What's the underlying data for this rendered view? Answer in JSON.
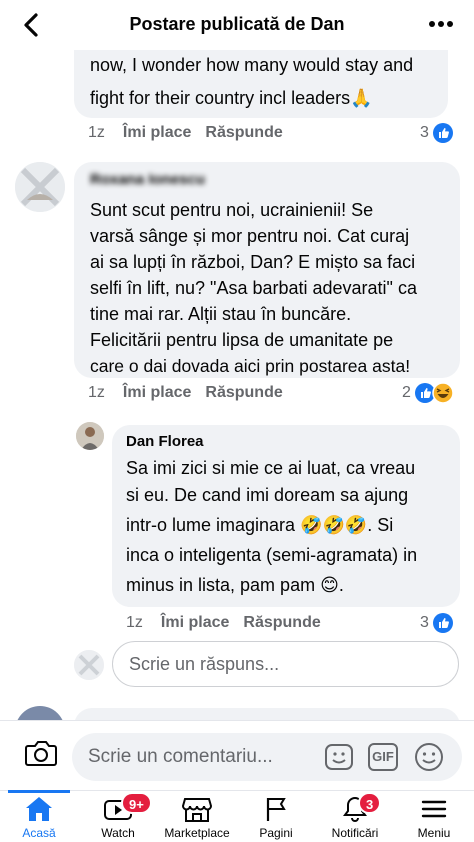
{
  "header": {
    "title": "Postare publicată de Dan",
    "back_icon": "chevron-left-icon",
    "more_icon": "more-dots-icon"
  },
  "comment1": {
    "text_line1": "now, I wonder how many would stay and",
    "text_line2": "fight for their country incl leaders🙏",
    "time": "1z",
    "like": "Îmi place",
    "reply": "Răspunde",
    "reaction_count": "3",
    "reactions": [
      "like"
    ]
  },
  "comment2": {
    "author": "Roxana Ionescu",
    "lines": [
      "Sunt scut pentru noi, ucrainienii! Se",
      "varsă sânge și mor pentru noi. Cat curaj",
      "ai sa lupți în război, Dan? E mișto sa faci",
      "selfi în lift, nu? \"Asa barbati adevarati\" ca",
      "tine mai rar. Alții stau în buncăre.",
      "Felicitării pentru lipsa de umanitate pe",
      "care o dai dovada aici prin postarea asta!"
    ],
    "time": "1z",
    "like": "Îmi place",
    "reply": "Răspunde",
    "reaction_count": "2",
    "reactions": [
      "like",
      "haha"
    ]
  },
  "reply1": {
    "author": "Dan Florea",
    "lines": [
      "Sa imi zici si mie ce ai luat, ca vreau",
      "si eu. De cand imi doream sa ajung",
      "intr-o lume imaginara 🤣🤣🤣. Si",
      "inca o inteligenta (semi-agramata) in",
      "minus in lista, pam pam 😊."
    ],
    "time": "1z",
    "like": "Îmi place",
    "reply": "Răspunde",
    "reaction_count": "3",
    "reactions": [
      "like"
    ]
  },
  "reply_input": {
    "placeholder": "Scrie un răspuns..."
  },
  "composer": {
    "placeholder": "Scrie un comentariu...",
    "camera_icon": "camera-icon",
    "sticker_icon": "sticker-icon",
    "gif_label": "GIF",
    "emoji_icon": "emoji-icon"
  },
  "tabbar": {
    "home": "Acasă",
    "watch": "Watch",
    "watch_badge": "9+",
    "marketplace": "Marketplace",
    "pages": "Pagini",
    "notifications": "Notificări",
    "notifications_badge": "3",
    "menu": "Meniu"
  },
  "colors": {
    "accent": "#1877f2",
    "bubble": "#f0f2f5",
    "muted": "#65676b",
    "badge": "#e41e3f"
  }
}
